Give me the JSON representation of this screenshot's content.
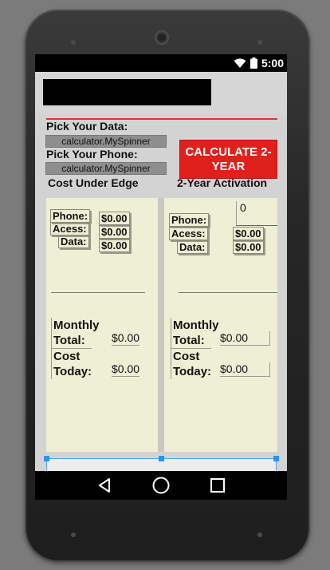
{
  "status_bar": {
    "time": "5:00",
    "icons": [
      "wifi-icon",
      "battery-icon"
    ]
  },
  "action_bar": {
    "title": ""
  },
  "form": {
    "pick_data_label": "Pick Your Data:",
    "data_spinner_value": "calculator.MySpinner",
    "pick_phone_label": "Pick Your Phone:",
    "phone_spinner_value": "calculator.MySpinner",
    "calculate_button": "CALCULATE 2-YEAR"
  },
  "left_panel": {
    "heading": "Cost Under Edge",
    "phone_label": "Phone:",
    "phone_value": "$0.00",
    "access_label": "Acess:",
    "access_value": "$0.00",
    "data_label": "Data:",
    "data_value": "$0.00",
    "monthly_label_1": "Monthly",
    "monthly_label_2": "Total:",
    "monthly_value": "$0.00",
    "cost_label_1": "Cost",
    "cost_label_2": "Today:",
    "cost_value": "$0.00"
  },
  "right_panel": {
    "heading": "2-Year Activation",
    "phone_label": "Phone:",
    "phone_value": "0",
    "access_label": "Acess:",
    "access_value": "$0.00",
    "data_label": "Data:",
    "data_value": "$0.00",
    "monthly_label_1": "Monthly",
    "monthly_label_2": "Total:",
    "monthly_value": "$0.00",
    "cost_label_1": "Cost",
    "cost_label_2": "Today:",
    "cost_value": "$0.00"
  },
  "colors": {
    "accent_red": "#e0201c",
    "panel_bg": "#efefd6",
    "selection_blue": "#2b93f0"
  }
}
